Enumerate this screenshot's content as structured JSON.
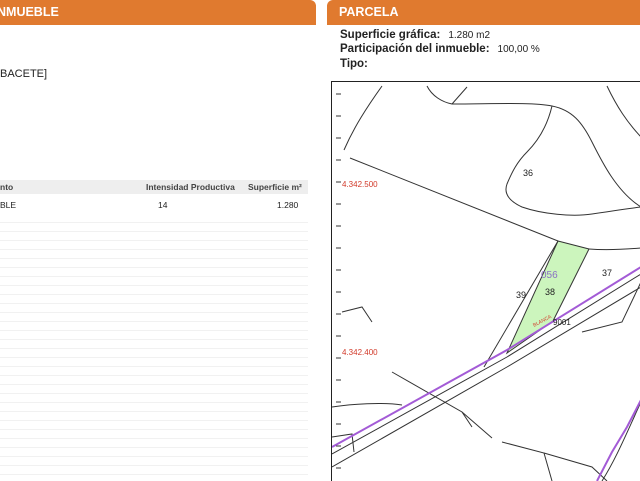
{
  "left_panel": {
    "header_title": "NMUEBLE",
    "address_fragment": "BACETE]",
    "table": {
      "columns": [
        "nto",
        "Intensidad Productiva",
        "Superficie m²"
      ],
      "rows": [
        {
          "name": "BLE",
          "intensity": "14",
          "surface": "1.280"
        }
      ]
    }
  },
  "right_panel": {
    "header_title": "PARCELA",
    "surface_label": "Superficie gráfica:",
    "surface_value": "1.280 m2",
    "participation_label": "Participación del inmueble:",
    "participation_value": "100,00 %",
    "type_label": "Tipo:",
    "type_value": ""
  },
  "map": {
    "coord_labels": [
      "4.342.500",
      "4.342.400"
    ],
    "parcel_labels": [
      "36",
      "37",
      "38",
      "39"
    ],
    "highlight_code": "056",
    "road_code": "9001",
    "road_name": "BLANCA",
    "colors": {
      "highlight_fill": "#ccf5bd",
      "road": "#a35bd6",
      "coord_text": "#d23a2a",
      "header": "#e07a2f"
    }
  }
}
